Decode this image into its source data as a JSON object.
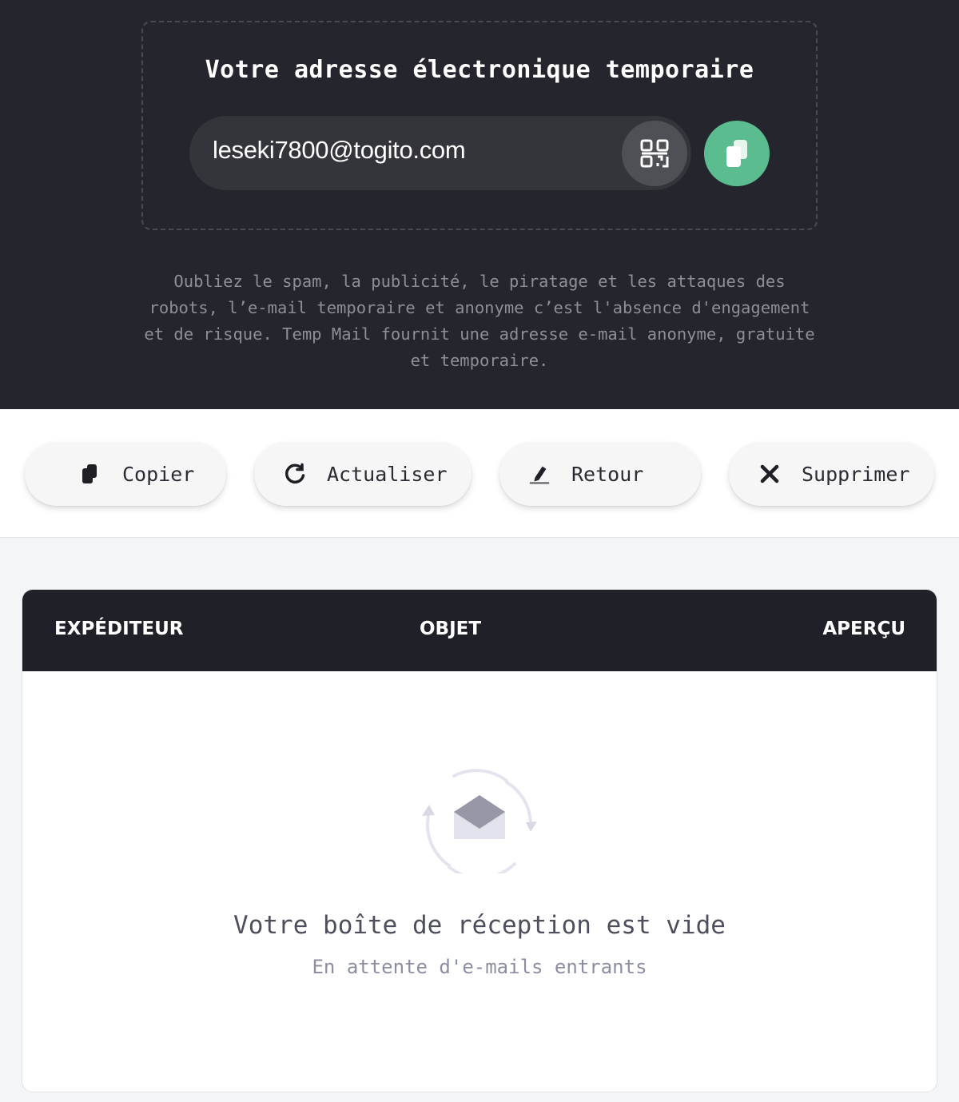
{
  "hero": {
    "title": "Votre adresse électronique temporaire",
    "email": "leseki7800@togito.com",
    "description": "Oubliez le spam, la publicité, le piratage et les attaques des robots, l’e-mail temporaire et anonyme c’est l'absence d'engagement et de risque. Temp Mail fournit une adresse e-mail anonyme, gratuite et temporaire.",
    "accent_color": "#5bbd8f"
  },
  "actions": {
    "copy": "Copier",
    "refresh": "Actualiser",
    "back": "Retour",
    "delete": "Supprimer"
  },
  "inbox": {
    "columns": [
      "EXPÉDITEUR",
      "OBJET",
      "APERÇU"
    ],
    "empty_title": "Votre boîte de réception est vide",
    "empty_subtitle": "En attente d'e-mails entrants"
  }
}
